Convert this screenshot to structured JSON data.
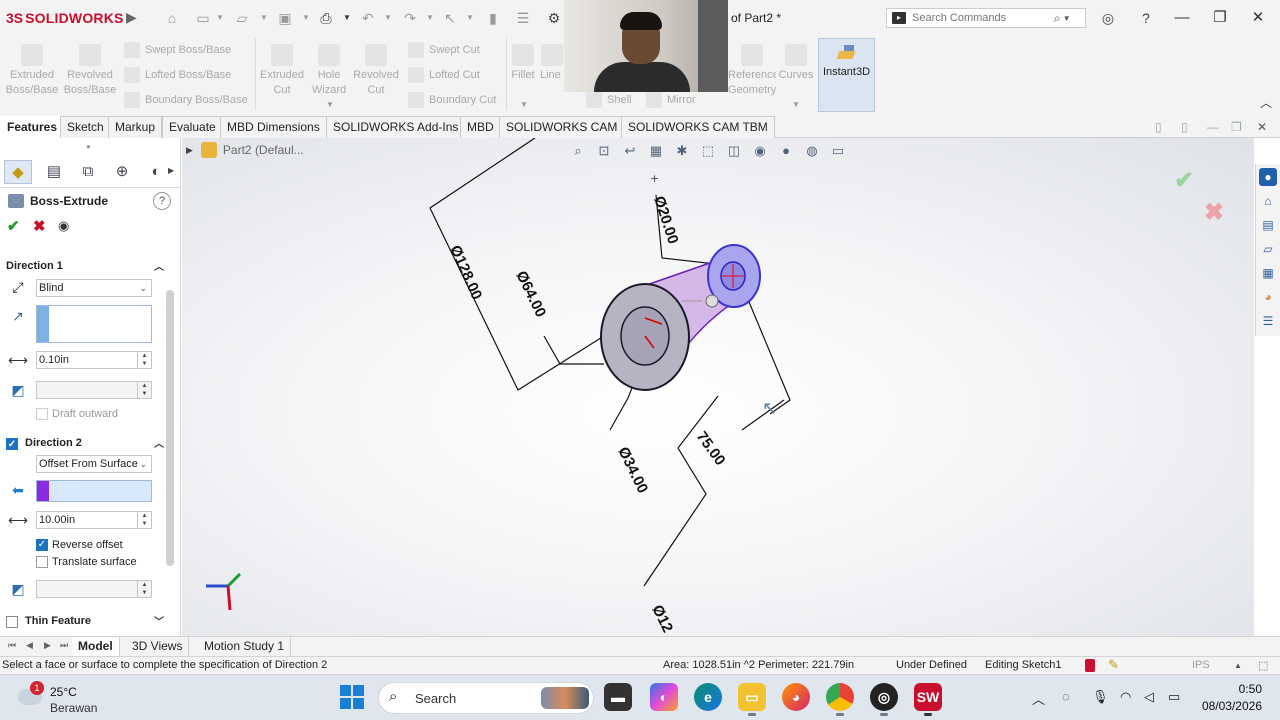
{
  "app": {
    "logo_prefix": "3S",
    "logo_text": "SOLIDWORKS",
    "document_title": "of Part2 *",
    "search_placeholder": "Search Commands"
  },
  "ribbon": {
    "extruded_boss": "Extruded Boss/Base",
    "revolved_boss": "Revolved Boss/Base",
    "swept_boss": "Swept Boss/Base",
    "lofted_boss": "Lofted Boss/Base",
    "boundary_boss": "Boundary Boss/Base",
    "extruded_cut": "Extruded Cut",
    "hole_wizard": "Hole Wizard",
    "revolved_cut": "Revolved Cut",
    "swept_cut": "Swept Cut",
    "lofted_cut": "Lofted Cut",
    "boundary_cut": "Boundary Cut",
    "fillet": "Fillet",
    "linear_pattern": "Line Patt",
    "shell": "Shell",
    "mirror": "Mirror",
    "reference_geometry": "Reference Geometry",
    "curves": "Curves",
    "instant3d": "Instant3D"
  },
  "tabs": [
    "Features",
    "Sketch",
    "Markup",
    "Evaluate",
    "MBD Dimensions",
    "SOLIDWORKS Add-Ins",
    "MBD",
    "SOLIDWORKS CAM",
    "SOLIDWORKS CAM TBM"
  ],
  "tree": {
    "part_label": "Part2 (Defaul..."
  },
  "property_manager": {
    "title": "Boss-Extrude",
    "direction1": {
      "label": "Direction 1",
      "end_condition": "Blind",
      "depth": "0.10in",
      "draft_label": "Draft outward"
    },
    "direction2": {
      "label": "Direction 2",
      "end_condition": "Offset From Surface",
      "offset": "10.00in",
      "reverse_offset_label": "Reverse offset",
      "reverse_offset_checked": true,
      "translate_surface_label": "Translate surface",
      "translate_surface_checked": false
    },
    "thin_feature_label": "Thin Feature"
  },
  "model_tabs": [
    "Model",
    "3D Views",
    "Motion Study 1"
  ],
  "status_bar": {
    "message": "Select a face or surface to complete the specification of Direction 2",
    "measure": "Area: 1028.51in ^2 Perimeter: 221.79in",
    "sketch_state": "Under Defined",
    "editing": "Editing Sketch1",
    "units": "IPS"
  },
  "dimensions": {
    "d1": "Ø128.00",
    "d2": "Ø64.00",
    "d3": "Ø34.00",
    "d4": "75.00",
    "d5": "Ø20.00",
    "d6": "Ø12"
  },
  "taskbar": {
    "weather_temp": "25°C",
    "weather_desc": "Berawan",
    "weather_badge": "1",
    "search_label": "Search",
    "time": "0:50",
    "date": "08/03/2026"
  },
  "colors": {
    "accent": "#1e73be",
    "brand_red": "#c8102e",
    "dir2_color": "#8a2be2",
    "ok_green": "#1a9a2a"
  }
}
